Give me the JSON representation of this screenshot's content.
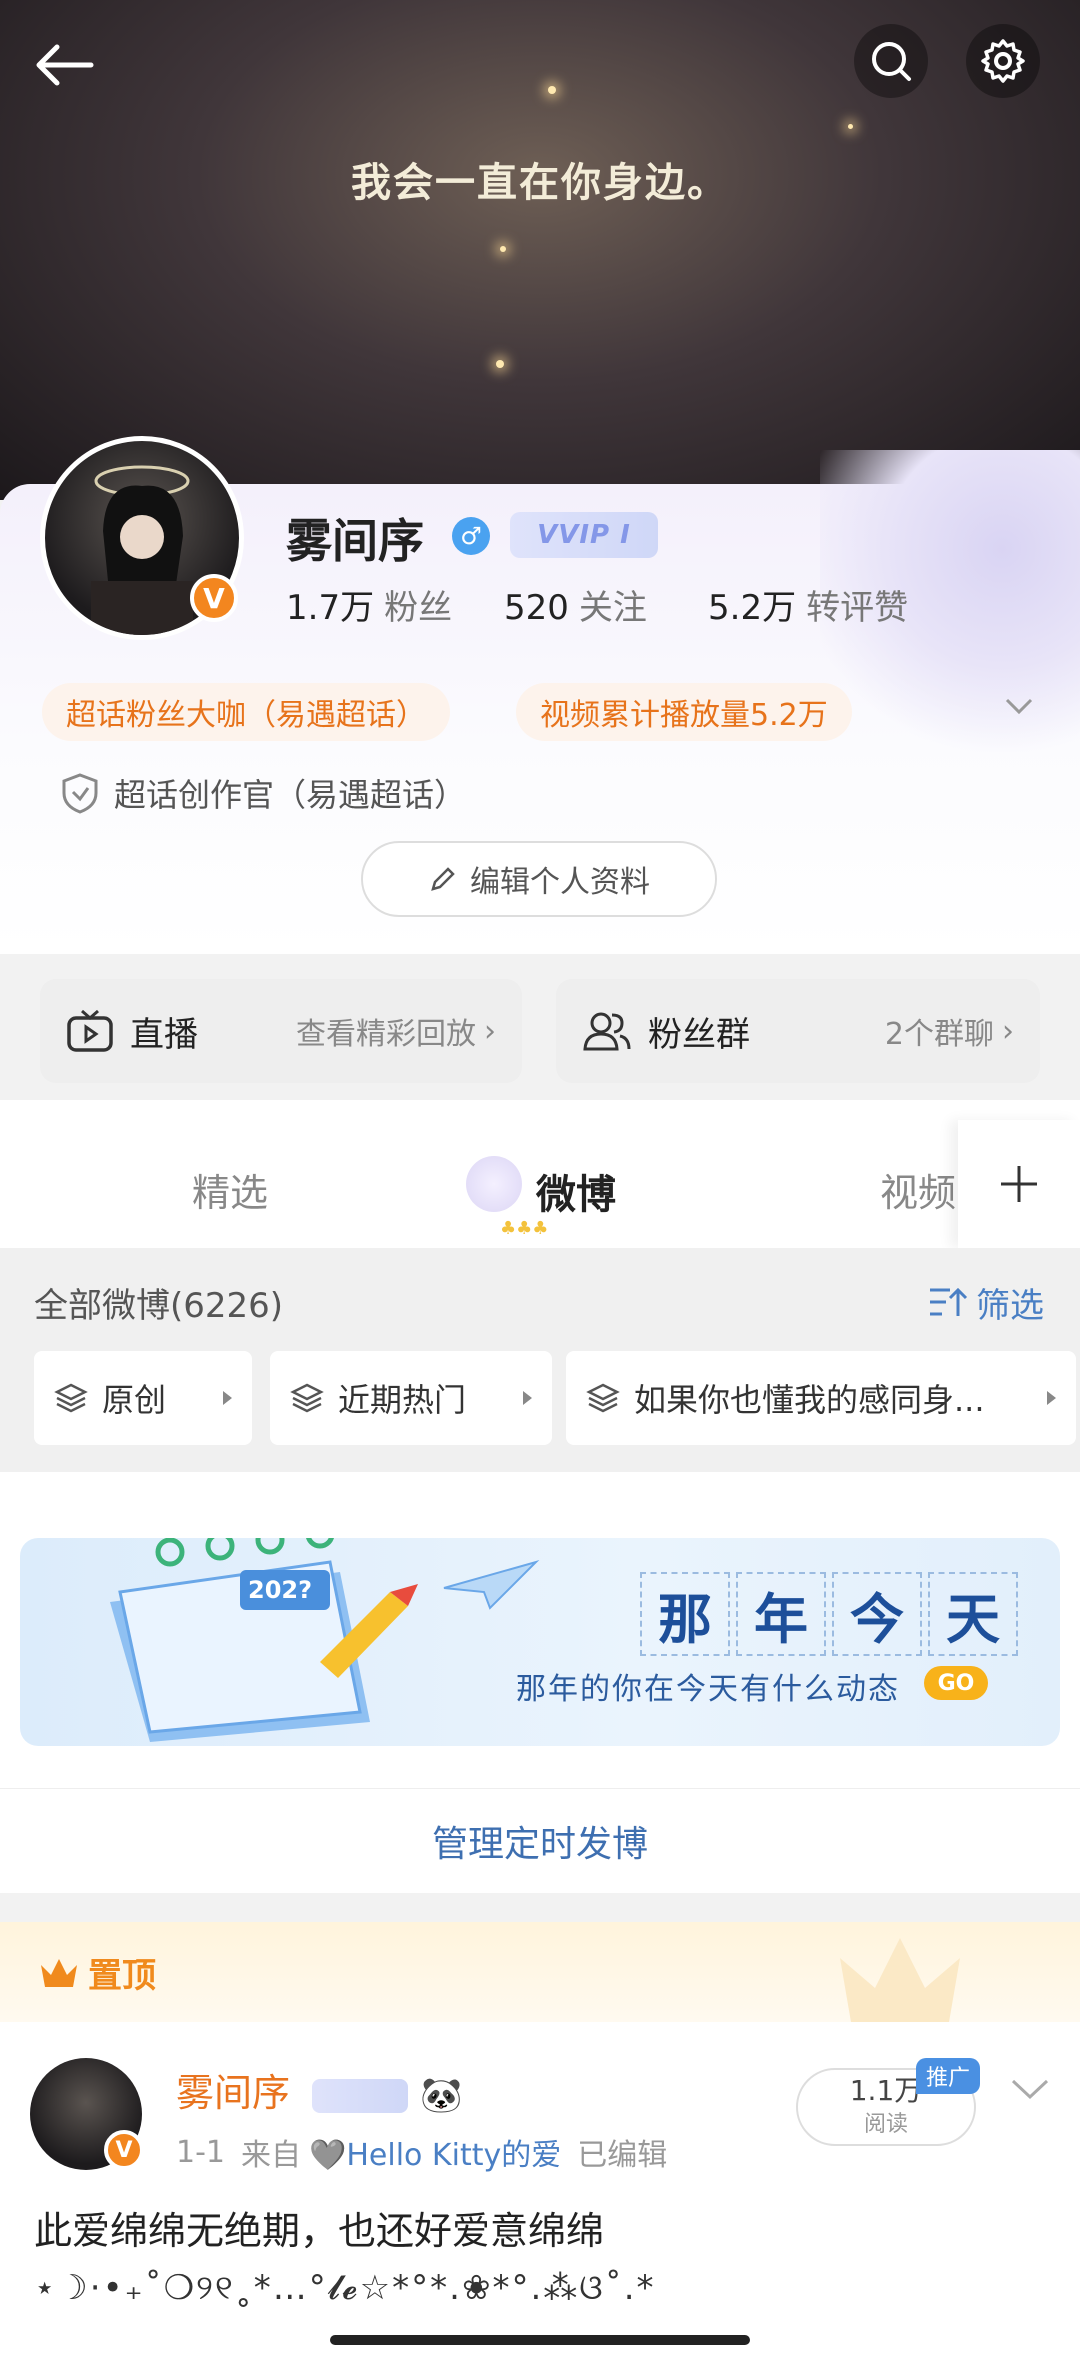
{
  "hero": {
    "quote": "我会一直在你身边。"
  },
  "profile": {
    "name": "雾间序",
    "gender_symbol": "♂",
    "vip_badge": "VVIP I",
    "verified_mark": "V",
    "stats": [
      {
        "value": "1.7万",
        "label": "粉丝"
      },
      {
        "value": "520",
        "label": "关注"
      },
      {
        "value": "5.2万",
        "label": "转评赞"
      }
    ],
    "chips": [
      "超话粉丝大咖（易遇超话）",
      "视频累计播放量5.2万"
    ],
    "certification": "超话创作官（易遇超话）",
    "edit_label": "编辑个人资料"
  },
  "tiles": {
    "live": {
      "title": "直播",
      "sub": "查看精彩回放"
    },
    "fans": {
      "title": "粉丝群",
      "sub": "2个群聊"
    }
  },
  "tabs": [
    "精选",
    "微博",
    "视频"
  ],
  "filter": {
    "total": "全部微博(6226)",
    "button": "筛选",
    "chips": [
      "原创",
      "近期热门",
      "如果你也懂我的感同身..."
    ]
  },
  "banner": {
    "year": "202?",
    "title_chars": [
      "那",
      "年",
      "今",
      "天"
    ],
    "subtitle": "那年的你在今天有什么动态",
    "go": "GO"
  },
  "manage_label": "管理定时发博",
  "pinned": {
    "label": "置顶",
    "author": "雾间序",
    "date": "1-1",
    "from_prefix": "来自",
    "source": "🩶Hello Kitty的爱",
    "edited": "已编辑",
    "reads_value": "1.1万",
    "reads_label": "阅读",
    "promo": "推广",
    "text": "此爱绵绵无绝期，也还好爱意绵绵",
    "decor": "⋆☽︎·•₊˚❍୨୧˳*…°𝓵𝓮☆*°*.❀*°.⁂ଓ˚.*"
  },
  "colors": {
    "accent_orange": "#e8731e",
    "link_blue": "#4a7fc4",
    "promo_blue": "#4a90e2"
  }
}
